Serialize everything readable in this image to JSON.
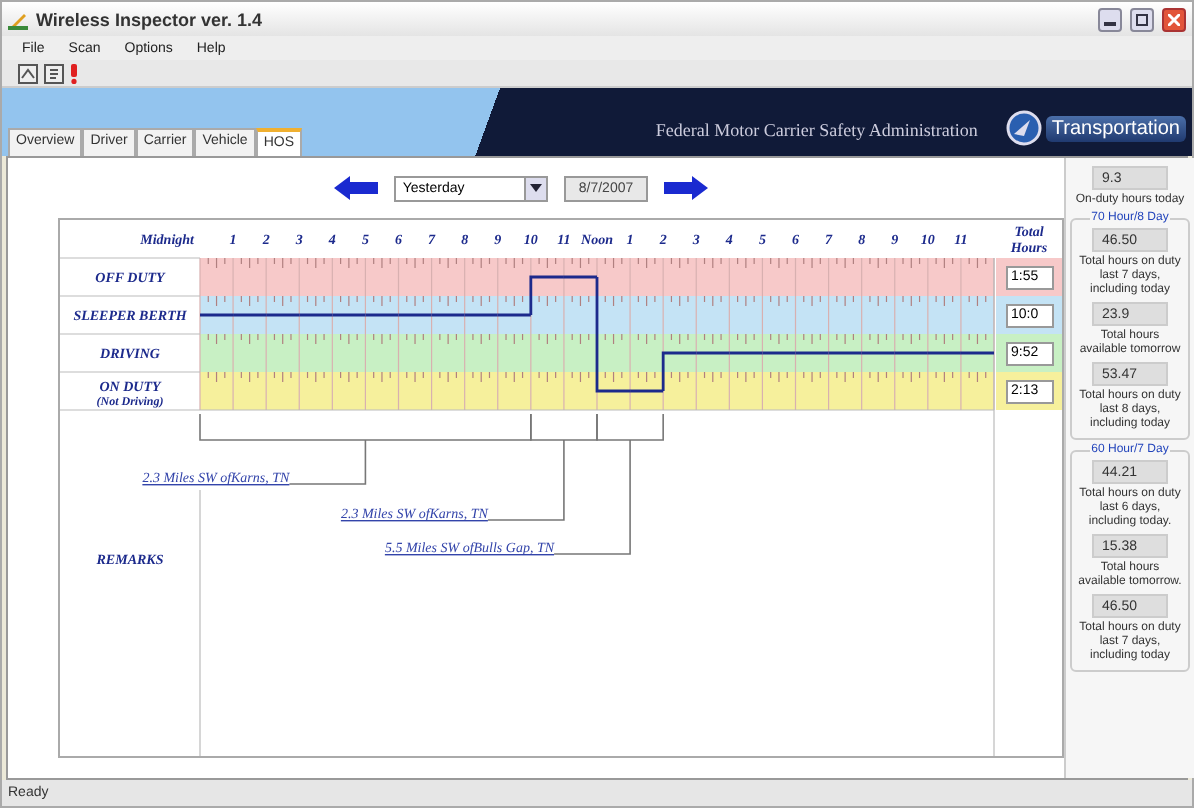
{
  "window": {
    "title": "Wireless Inspector ver. 1.4"
  },
  "menu": [
    "File",
    "Scan",
    "Options",
    "Help"
  ],
  "banner": {
    "agency": "Federal Motor Carrier Safety Administration",
    "department": "Transportation"
  },
  "tabs": [
    {
      "label": "Overview",
      "selected": false
    },
    {
      "label": "Driver",
      "selected": false
    },
    {
      "label": "Carrier",
      "selected": false
    },
    {
      "label": "Vehicle",
      "selected": false
    },
    {
      "label": "HOS",
      "selected": true
    }
  ],
  "date_nav": {
    "period": "Yesterday",
    "date": "8/7/2007"
  },
  "graph": {
    "hour_labels": [
      "Midnight",
      "1",
      "2",
      "3",
      "4",
      "5",
      "6",
      "7",
      "8",
      "9",
      "10",
      "11",
      "Noon",
      "1",
      "2",
      "3",
      "4",
      "5",
      "6",
      "7",
      "8",
      "9",
      "10",
      "11"
    ],
    "totals_header": "Total Hours",
    "duty_rows": [
      {
        "label": "OFF DUTY",
        "total": "1:55",
        "color": "#f7c9c9",
        "active_hours": [
          false,
          false,
          false,
          false,
          false,
          false,
          false,
          false,
          false,
          false,
          true,
          true,
          false,
          false,
          false,
          false,
          false,
          false,
          false,
          false,
          false,
          false,
          false,
          false
        ]
      },
      {
        "label": "SLEEPER BERTH",
        "total": "10:0",
        "color": "#c4e3f5",
        "active_hours": [
          true,
          true,
          true,
          true,
          true,
          true,
          true,
          true,
          true,
          true,
          false,
          false,
          false,
          false,
          false,
          false,
          false,
          false,
          false,
          false,
          false,
          false,
          false,
          false
        ]
      },
      {
        "label": "DRIVING",
        "total": "9:52",
        "color": "#c8f0c4",
        "active_hours": [
          false,
          false,
          false,
          false,
          false,
          false,
          false,
          false,
          false,
          false,
          false,
          false,
          false,
          false,
          true,
          true,
          true,
          true,
          true,
          true,
          true,
          true,
          true,
          true
        ]
      },
      {
        "label": "ON DUTY",
        "note": "(Not Driving)",
        "total": "2:13",
        "color": "#f6f09c",
        "active_hours": [
          false,
          false,
          false,
          false,
          false,
          false,
          false,
          false,
          false,
          false,
          false,
          false,
          true,
          true,
          false,
          false,
          false,
          false,
          false,
          false,
          false,
          false,
          false,
          false
        ]
      }
    ],
    "remarks_label": "REMARKS",
    "remarks": [
      "2.3 Miles SW ofKarns, TN",
      "2.3 Miles SW ofKarns, TN",
      "5.5 Miles SW ofBulls Gap, TN"
    ]
  },
  "summary": {
    "today_value": "9.3",
    "today_caption": "On-duty hours today",
    "groups": [
      {
        "title": "70 Hour/8 Day",
        "items": [
          {
            "value": "46.50",
            "caption": "Total hours on duty last 7 days, including today"
          },
          {
            "value": "23.9",
            "caption": "Total hours available tomorrow"
          },
          {
            "value": "53.47",
            "caption": "Total hours on duty last 8 days, including today"
          }
        ]
      },
      {
        "title": "60 Hour/7 Day",
        "items": [
          {
            "value": "44.21",
            "caption": "Total hours on duty last 6 days, including today."
          },
          {
            "value": "15.38",
            "caption": "Total hours available tomorrow."
          },
          {
            "value": "46.50",
            "caption": "Total hours on duty last 7 days, including today"
          }
        ]
      }
    ]
  },
  "status_bar": "Ready"
}
